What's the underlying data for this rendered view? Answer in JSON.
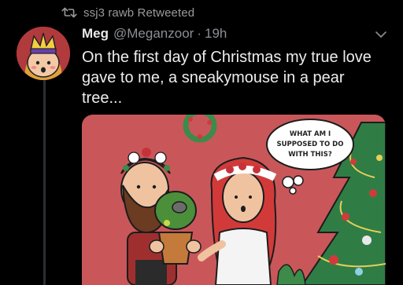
{
  "retweet": {
    "icon": "retweet-icon",
    "text": "ssj3 rawb Retweeted"
  },
  "tweet": {
    "display_name": "Meg",
    "handle": "@Meganzoor",
    "separator": "·",
    "time": "19h",
    "text": "On the first day of Christmas my true love gave to me, a sneakymouse in a pear tree...",
    "more_icon": "chevron-down-icon"
  },
  "media": {
    "speech_bubble": {
      "line1": "WHAT AM I",
      "line2": "SUPPOSED TO DO",
      "line3": "WITH THIS?"
    }
  },
  "colors": {
    "background": "#000000",
    "comic_background": "#c9575a",
    "handle_gray": "#8b8f94"
  }
}
